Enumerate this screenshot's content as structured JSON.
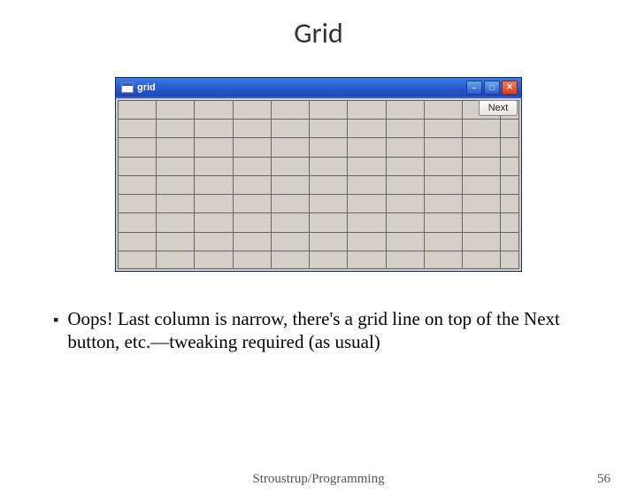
{
  "title": "Grid",
  "window": {
    "title": "grid",
    "next_button": "Next",
    "grid": {
      "rows": 9,
      "cols": 11
    },
    "controls": {
      "minimize": "_",
      "maximize": "□",
      "close": "✕"
    }
  },
  "bullet": "Oops!  Last column is narrow, there's a grid line on top of the Next button, etc.—tweaking required (as usual)",
  "footer": "Stroustrup/Programming",
  "page_number": "56"
}
